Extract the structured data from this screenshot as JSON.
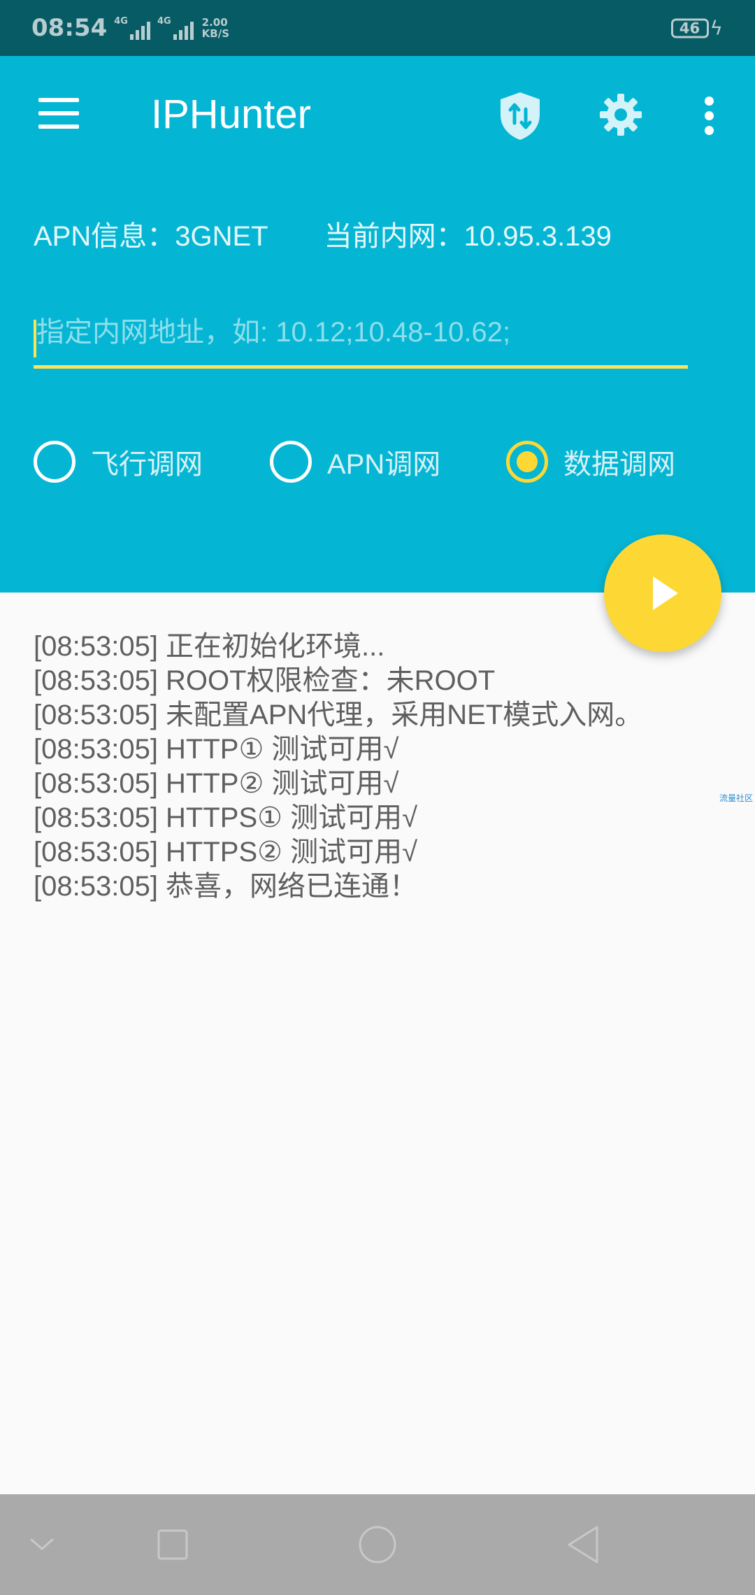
{
  "status_bar": {
    "time": "08:54",
    "signal1_label": "4G",
    "signal2_label": "4G",
    "net_speed_value": "2.00",
    "net_speed_unit": "KB/S",
    "battery": "46"
  },
  "app_bar": {
    "title": "IPHunter",
    "icons": [
      "menu-icon",
      "shield-icon",
      "gear-icon",
      "more-icon"
    ]
  },
  "info": {
    "apn": "APN信息：3GNET",
    "intranet": "当前内网：10.95.3.139"
  },
  "ip_input": {
    "value": "",
    "placeholder": "指定内网地址，如: 10.12;10.48-10.62;"
  },
  "modes": [
    {
      "label": "飞行调网",
      "checked": false
    },
    {
      "label": "APN调网",
      "checked": false
    },
    {
      "label": "数据调网",
      "checked": true
    }
  ],
  "log": [
    "[08:53:05] 正在初始化环境...",
    "[08:53:05] ROOT权限检查：未ROOT",
    "[08:53:05] 未配置APN代理，采用NET模式入网。",
    "[08:53:05] HTTP①  测试可用√",
    "[08:53:05] HTTP②  测试可用√",
    "[08:53:05] HTTPS① 测试可用√",
    "[08:53:05] HTTPS② 测试可用√",
    "[08:53:05] 恭喜，网络已连通！"
  ],
  "watermark": "流量社区",
  "colors": {
    "status_bar": "#075b64",
    "primary": "#05b6d4",
    "accent": "#fdd835",
    "nav_bar": "#aaaaaa"
  }
}
